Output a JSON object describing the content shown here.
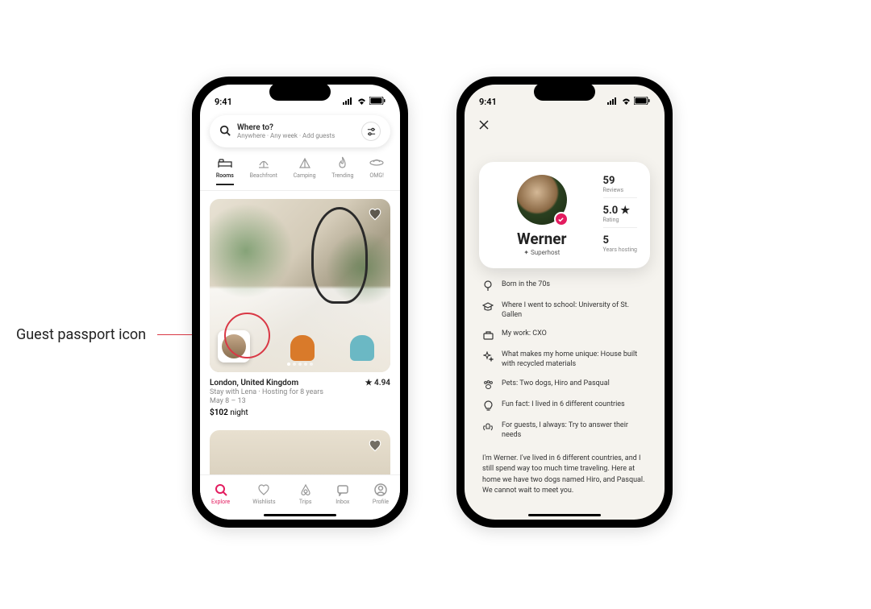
{
  "annotation": {
    "label": "Guest passport icon"
  },
  "status": {
    "time": "9:41"
  },
  "search": {
    "title": "Where to?",
    "sub": "Anywhere · Any week · Add guests"
  },
  "categories": [
    {
      "label": "Rooms",
      "active": true
    },
    {
      "label": "Beachfront",
      "active": false
    },
    {
      "label": "Camping",
      "active": false
    },
    {
      "label": "Trending",
      "active": false
    },
    {
      "label": "OMG!",
      "active": false
    }
  ],
  "listing": {
    "location": "London, United Kingdom",
    "rating": "★ 4.94",
    "host": "Stay with Lena · Hosting for 8 years",
    "dates": "May 8 – 13",
    "price": "$102",
    "price_unit": " night"
  },
  "nav": [
    {
      "label": "Explore",
      "active": true
    },
    {
      "label": "Wishlists",
      "active": false
    },
    {
      "label": "Trips",
      "active": false
    },
    {
      "label": "Inbox",
      "active": false
    },
    {
      "label": "Profile",
      "active": false
    }
  ],
  "host": {
    "name": "Werner",
    "role": "Superhost",
    "reviews_count": "59",
    "reviews_label": "Reviews",
    "rating": "5.0 ★",
    "rating_label": "Rating",
    "years": "5",
    "years_label": "Years hosting"
  },
  "details": [
    "Born in the 70s",
    "Where I went to school: University of St. Gallen",
    "My work: CXO",
    "What makes my home unique: House built with recycled materials",
    "Pets: Two dogs, Hiro and Pasqual",
    "Fun fact: I lived in 6 different countries",
    "For guests, I always: Try to answer their needs"
  ],
  "bio": "I'm Werner. I've lived in 6 different countries, and I still spend way too much time traveling. Here at home we have two dogs named Hiro, and Pasqual. We cannot wait to meet you."
}
